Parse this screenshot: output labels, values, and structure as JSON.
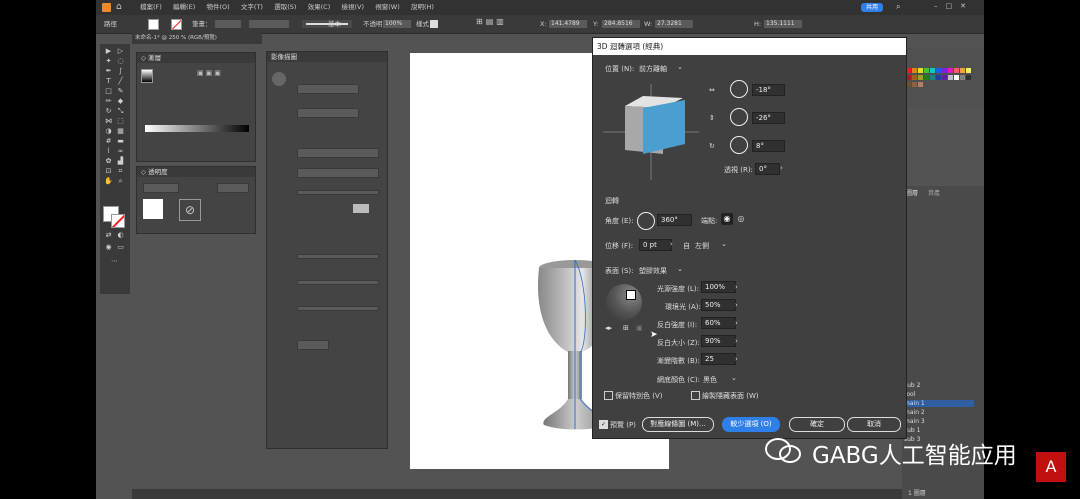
{
  "menu": {
    "items": [
      "檔案(F)",
      "編輯(E)",
      "物件(O)",
      "文字(T)",
      "選取(S)",
      "效果(C)",
      "檢視(V)",
      "視窗(W)",
      "說明(H)"
    ],
    "share_label": "共用"
  },
  "control_bar": {
    "label": "路徑",
    "stroke_label": "筆畫：",
    "basic_label": "基本",
    "opacity_label": "不透明度：",
    "opacity_value": "100%",
    "style_label": "樣式：",
    "x_value": "141.4789",
    "y_value": "284.8516",
    "w_value": "27.3281",
    "h_value": "135.1111"
  },
  "document_tab": {
    "title": "未命名-1* @ 250 % (RGB/預覽)"
  },
  "dialog": {
    "title": "3D 迴轉選項 (經典)",
    "position_label": "位置 (N):",
    "position_value": "前方離軸",
    "rot_x": "-18°",
    "rot_y": "-26°",
    "rot_z": "8°",
    "perspective_label": "透視 (R):",
    "perspective_value": "0°",
    "revolve_section": "迴轉",
    "angle_label": "角度 (E):",
    "angle_value": "360°",
    "cap_label": "端點:",
    "offset_label": "位移 (F):",
    "offset_value": "0 pt",
    "from_label": "自",
    "from_value": "左側",
    "surface_label": "表面 (S):",
    "surface_value": "塑膠效果",
    "light_intensity_label": "光源強度 (L):",
    "light_intensity_value": "100%",
    "ambient_label": "環境光 (A):",
    "ambient_value": "50%",
    "highlight_intensity_label": "反白強度 (I):",
    "highlight_intensity_value": "60%",
    "highlight_size_label": "反白大小 (Z):",
    "highlight_size_value": "90%",
    "blend_steps_label": "漸變階數 (B):",
    "blend_steps_value": "25",
    "shade_color_label": "網底顏色 (C):",
    "shade_color_value": "黑色",
    "preserve_spot_label": "保留特別色 (V)",
    "draw_hidden_label": "繪製隱藏表面 (W)",
    "preview_label": "預覽 (P)",
    "map_art_label": "對應線條圖 (M)...",
    "fewer_options_label": "較少選項 (O)",
    "ok_label": "確定",
    "cancel_label": "取消"
  },
  "layers": {
    "tabs": [
      "圖層",
      "資產"
    ],
    "items": [
      "sub 2",
      "tool",
      "main 1",
      "main 2",
      "main 3",
      "sub 1",
      "sub 3"
    ],
    "count_label": "1 圖層"
  },
  "colors": {
    "app_bg": "#535353",
    "dialog_bg": "#404040",
    "cube_front": "#4a9fd0",
    "cube_top": "#e3e3e3",
    "cube_side": "#a8a8a8",
    "primary_button": "#2f7fe8"
  },
  "watermark": {
    "text": "GABG人工智能应用"
  }
}
